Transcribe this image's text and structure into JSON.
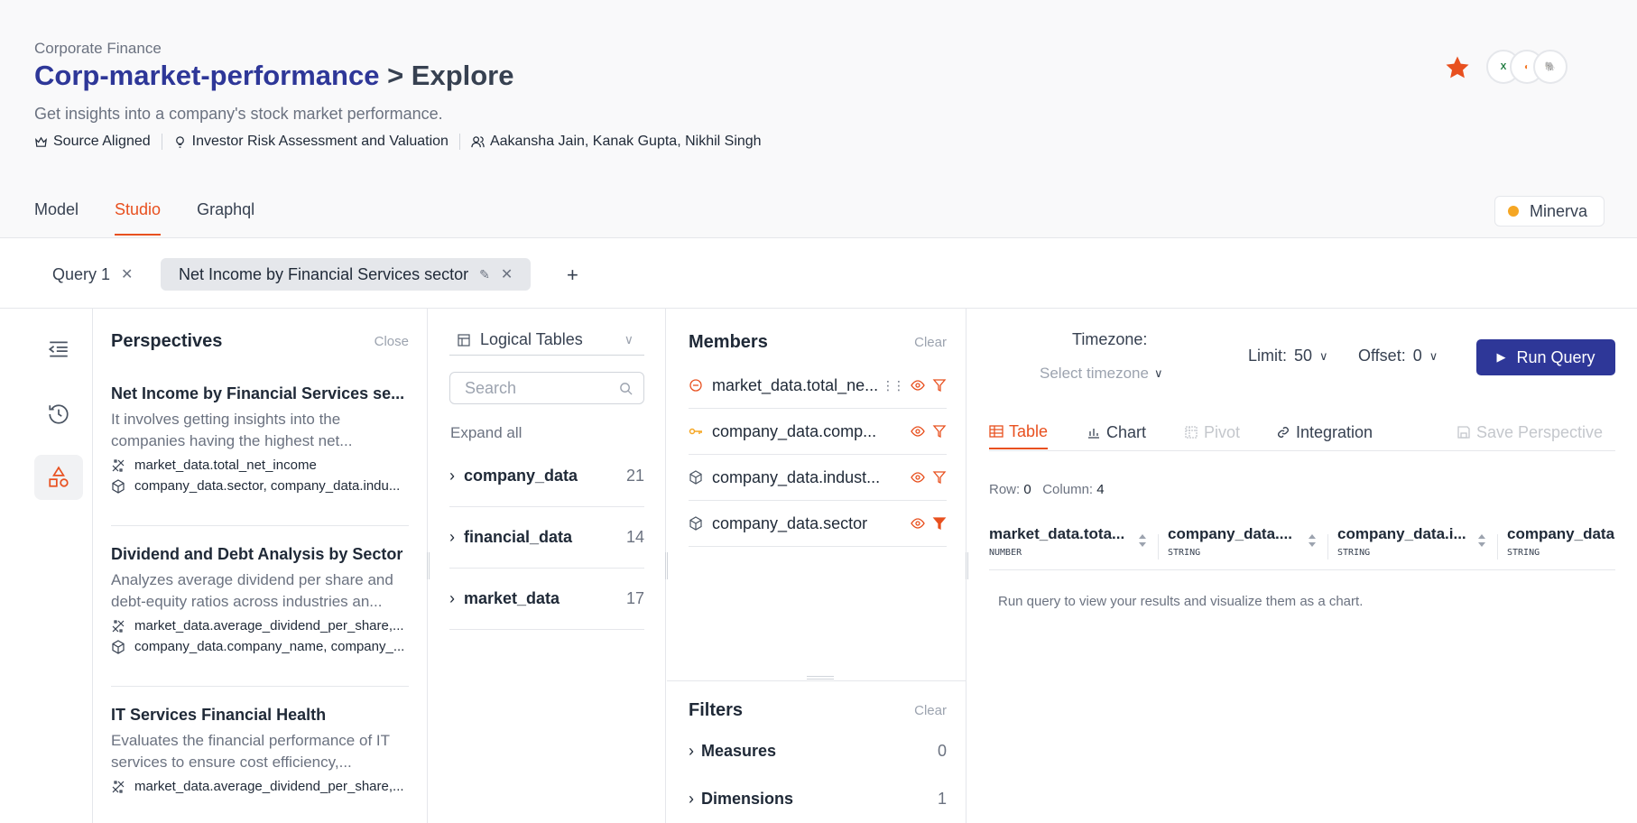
{
  "header": {
    "breadcrumb": "Corporate Finance",
    "title": "Corp-market-performance",
    "title_suffix": "> Explore",
    "subtitle": "Get insights into a company's stock market performance.",
    "meta": {
      "alignment": "Source Aligned",
      "use_case": "Investor Risk Assessment and Valuation",
      "owners": "Aakansha Jain, Kanak Gupta, Nikhil Singh"
    },
    "star_color": "#e8501f",
    "avatars": [
      "excel-icon",
      "jupyter-icon",
      "postgres-icon"
    ]
  },
  "tabs": [
    {
      "label": "Model",
      "active": false
    },
    {
      "label": "Studio",
      "active": true
    },
    {
      "label": "Graphql",
      "active": false
    }
  ],
  "cluster": {
    "label": "Minerva",
    "status_color": "#f5a623"
  },
  "query_tabs": [
    {
      "label": "Query 1",
      "active": false
    },
    {
      "label": "Net Income by Financial Services sector",
      "active": true
    }
  ],
  "perspectives": {
    "title": "Perspectives",
    "close_label": "Close",
    "items": [
      {
        "title": "Net Income by Financial Services se...",
        "desc": "It involves getting insights into the companies having the highest net...",
        "measures": "market_data.total_net_income",
        "dimensions": "company_data.sector, company_data.indu..."
      },
      {
        "title": "Dividend and Debt Analysis by Sector",
        "desc": "Analyzes average dividend per share and debt-equity ratios across industries an...",
        "measures": "market_data.average_dividend_per_share,...",
        "dimensions": "company_data.company_name, company_..."
      },
      {
        "title": "IT Services Financial Health",
        "desc": "Evaluates the financial performance of IT services to ensure cost efficiency,...",
        "measures": "market_data.average_dividend_per_share,..."
      }
    ]
  },
  "logical_tables": {
    "selector_label": "Logical Tables",
    "search_placeholder": "Search",
    "expand_all": "Expand all",
    "tables": [
      {
        "name": "company_data",
        "count": "21"
      },
      {
        "name": "financial_data",
        "count": "14"
      },
      {
        "name": "market_data",
        "count": "17"
      }
    ]
  },
  "members": {
    "title": "Members",
    "clear_label": "Clear",
    "items": [
      {
        "name": "market_data.total_ne...",
        "kind": "measure-icon"
      },
      {
        "name": "company_data.comp...",
        "kind": "key-icon"
      },
      {
        "name": "company_data.indust...",
        "kind": "dimension-icon"
      },
      {
        "name": "company_data.sector",
        "kind": "dimension-icon",
        "filtered": true
      }
    ]
  },
  "filters": {
    "title": "Filters",
    "clear_label": "Clear",
    "items": [
      {
        "name": "Measures",
        "count": "0"
      },
      {
        "name": "Dimensions",
        "count": "1"
      }
    ]
  },
  "results": {
    "timezone_label": "Timezone:",
    "timezone_placeholder": "Select timezone",
    "limit_label": "Limit:",
    "limit_value": "50",
    "offset_label": "Offset:",
    "offset_value": "0",
    "run_label": "Run Query",
    "tabs": [
      {
        "label": "Table",
        "active": true
      },
      {
        "label": "Chart",
        "active": false
      },
      {
        "label": "Pivot",
        "disabled": true
      },
      {
        "label": "Integration",
        "active": false
      }
    ],
    "save_label": "Save Perspective",
    "row_label": "Row:",
    "row_value": "0",
    "col_label": "Column:",
    "col_value": "4",
    "columns": [
      {
        "name": "market_data.tota...",
        "type": "NUMBER"
      },
      {
        "name": "company_data....",
        "type": "STRING"
      },
      {
        "name": "company_data.i...",
        "type": "STRING"
      },
      {
        "name": "company_data",
        "type": "STRING"
      }
    ],
    "empty_message": "Run query to view your results and visualize them as a chart."
  },
  "colors": {
    "accent": "#e8501f",
    "primary": "#2e3798"
  }
}
